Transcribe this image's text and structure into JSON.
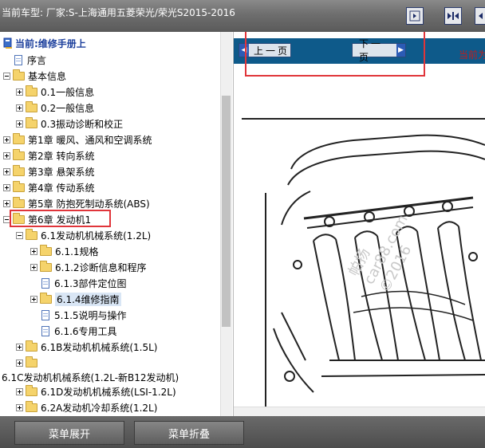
{
  "header": {
    "vehicle_text": "当前车型:   厂家:S-上海通用五菱荣光/荣光S2015-2016",
    "buttons": [
      {
        "icon": "page-arrow-icon"
      },
      {
        "icon": "expand-panes-icon"
      },
      {
        "icon": "collapse-panes-icon"
      }
    ]
  },
  "tree": {
    "title": "当前:维修手册上",
    "items": [
      {
        "label": "序言",
        "icon": "document-icon"
      },
      {
        "label": "基本信息",
        "icon": "folder-icon"
      },
      {
        "label": "0.1一般信息",
        "icon": "folder-icon"
      },
      {
        "label": "0.2一般信息",
        "icon": "folder-icon"
      },
      {
        "label": "0.3振动诊断和校正",
        "icon": "folder-icon"
      },
      {
        "label": "第1章 暖风、通风和空调系统",
        "icon": "folder-icon"
      },
      {
        "label": "第2章 转向系统",
        "icon": "folder-icon"
      },
      {
        "label": "第3章 悬架系统",
        "icon": "folder-icon"
      },
      {
        "label": "第4章 传动系统",
        "icon": "folder-icon"
      },
      {
        "label": "第5章 防抱死制动系统(ABS)",
        "icon": "folder-icon"
      },
      {
        "label": "第6章 发动机1",
        "icon": "folder-icon"
      },
      {
        "label": "6.1发动机机械系统(1.2L)",
        "icon": "folder-icon"
      },
      {
        "label": "6.1.1规格",
        "icon": "folder-icon"
      },
      {
        "label": "6.1.2诊断信息和程序",
        "icon": "folder-icon"
      },
      {
        "label": "6.1.3部件定位图",
        "icon": "document-icon"
      },
      {
        "label": "6.1.4维修指南",
        "icon": "folder-icon"
      },
      {
        "label": "5.1.5说明与操作",
        "icon": "document-icon"
      },
      {
        "label": "6.1.6专用工具",
        "icon": "document-icon"
      },
      {
        "label": "6.1B发动机机械系统(1.5L)",
        "icon": "folder-icon"
      },
      {
        "label": "",
        "icon": "folder-icon"
      },
      {
        "label": "6.1C发动机机械系统(1.2L-新B12发动机)",
        "icon": "none"
      },
      {
        "label": "6.1D发动机机械系统(LSI-1.2L)",
        "icon": "folder-icon"
      },
      {
        "label": "6.2A发动机冷却系统(1.2L)",
        "icon": "folder-icon"
      }
    ]
  },
  "nav": {
    "prev_label": "上一页",
    "next_label": "下一页",
    "current_text": "当前为"
  },
  "footer": {
    "expand_label": "菜单展开",
    "collapse_label": "菜单折叠"
  },
  "watermark": {
    "line1": "帕扬",
    "line2": "car88.com",
    "line3": "©2016"
  },
  "colors": {
    "highlight_border": "#e0353a",
    "nav_bar": "#0e5a8a",
    "tree_title": "#1c3f9c"
  }
}
